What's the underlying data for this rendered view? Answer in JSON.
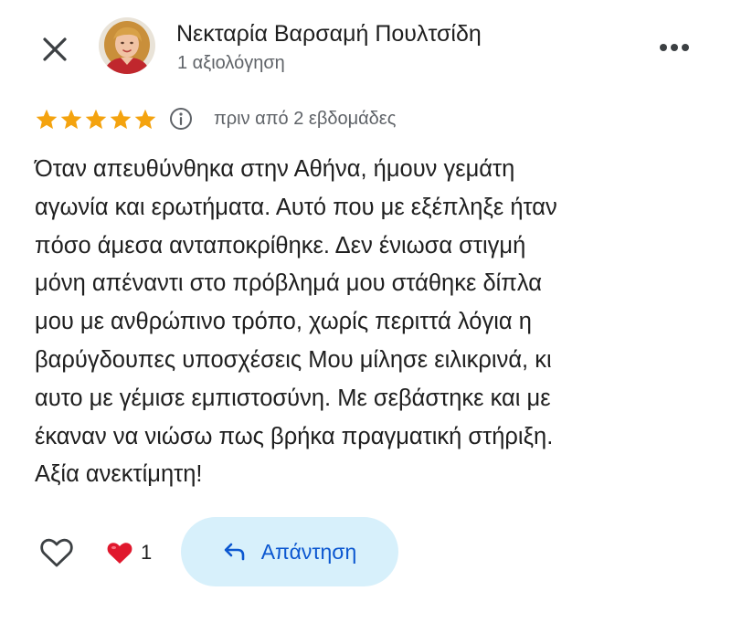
{
  "header": {
    "close_icon": "close-icon",
    "more_icon": "more-horizontal-icon",
    "author_name": "Νεκταρία Βαρσαμή Πουλτσίδη",
    "author_meta": "1 αξιολόγηση"
  },
  "review": {
    "rating": 5,
    "rating_max": 5,
    "star_color": "#f4a30f",
    "date": "πριν από 2 εβδομάδες",
    "lines": [
      "Όταν απευθύνθηκα στην Αθήνα, ήμουν γεμάτη",
      "αγωνία και ερωτήματα. Αυτό που με εξέπληξε ήταν",
      "πόσο άμεσα ανταποκρίθηκε. Δεν ένιωσα στιγμή",
      "μόνη απέναντι στο πρόβλημά μου στάθηκε δίπλα",
      "μου με ανθρώπινο τρόπο, χωρίς περιττά λόγια η",
      "βαρύγδουπες υποσχέσεις Μου μίλησε ειλικρινά, κι",
      "αυτο με γέμισε εμπιστοσύνη. Με σεβάστηκε και με",
      "έκαναν να νιώσω πως βρήκα πραγματική στήριξη.",
      "Αξία ανεκτίμητη!"
    ]
  },
  "actions": {
    "like_icon": "heart-outline-icon",
    "reaction_icon": "red-heart-icon",
    "reaction_count": "1",
    "reply_icon": "reply-arrow-icon",
    "reply_label": "Απάντηση",
    "reply_bg": "#d7f0fb",
    "reply_color": "#0b57d0"
  }
}
